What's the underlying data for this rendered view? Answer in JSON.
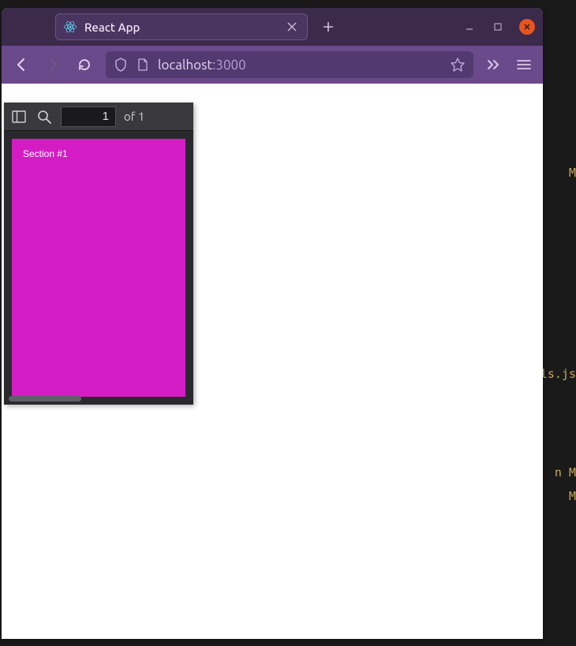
{
  "tab": {
    "title": "React App",
    "favicon": "react-logo"
  },
  "window_controls": {
    "minimize": "−",
    "maximize": "⛶",
    "close": "×"
  },
  "nav": {
    "back": "←",
    "forward": "→",
    "reload": "↻"
  },
  "url": {
    "host": "localhost",
    "port": ":3000"
  },
  "pdf": {
    "current_page": "1",
    "page_total": "of 1",
    "section_title": "Section #1"
  },
  "bg_hints": {
    "line1": "M",
    "line2": "ls.js",
    "line3": "n M",
    "line4": "M"
  }
}
